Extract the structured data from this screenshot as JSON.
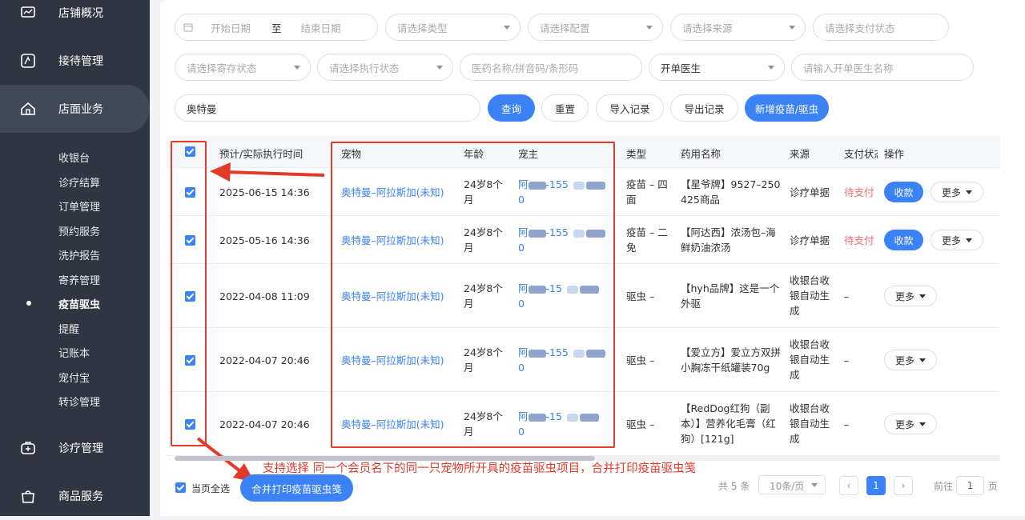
{
  "sidebar": {
    "top_items": [
      {
        "label": "店铺概况",
        "icon": "store-overview-icon"
      },
      {
        "label": "接待管理",
        "icon": "reception-icon"
      },
      {
        "label": "店面业务",
        "icon": "home-icon"
      }
    ],
    "sub_items": [
      "收银台",
      "诊疗结算",
      "订单管理",
      "预约服务",
      "洗护报告",
      "寄养管理",
      "疫苗驱虫",
      "提醒",
      "记账本",
      "宠付宝",
      "转诊管理"
    ],
    "active_sub": "疫苗驱虫",
    "bottom_items": [
      {
        "label": "诊疗管理",
        "icon": "medical-kit-icon"
      },
      {
        "label": "商品服务",
        "icon": "shopping-bag-icon"
      }
    ]
  },
  "filters": {
    "start_date": "开始日期",
    "date_sep": "至",
    "end_date": "结束日期",
    "type": "请选择类型",
    "config": "请选择配置",
    "source": "请选择来源",
    "pay_status": "请选择支付状态",
    "storage_status": "请选择寄存状态",
    "exec_status": "请选择执行状态",
    "drug_search": "医药名称/拼音码/条形码",
    "doctor_select": "开单医生",
    "doctor_name": "请输入开单医生名称",
    "keyword": "奥特曼"
  },
  "actions": {
    "query": "查询",
    "reset": "重置",
    "import": "导入记录",
    "export": "导出记录",
    "add": "新增疫苗/驱虫"
  },
  "table": {
    "headers": {
      "time": "预计/实际执行时间",
      "pet": "宠物",
      "age": "年龄",
      "owner": "宠主",
      "type": "类型",
      "drug": "药用名称",
      "source": "来源",
      "pay": "支付状态",
      "ops": "操作"
    },
    "rows": [
      {
        "time": "2025-06-15 14:36",
        "pet": "奥特曼–阿拉斯加(未知)",
        "age1": "24岁8个",
        "age2": "月",
        "owner1": "阿",
        "owner_mid": "-155",
        "owner2": "0",
        "type1": "疫苗 – 四",
        "type2": "面",
        "drug1": "【星爷牌】9527–250",
        "drug2": "425商品",
        "drug3": "",
        "source1": "诊疗单据",
        "source2": "",
        "source3": "",
        "pay": "待支付",
        "pay_btn": "收款",
        "more": "更多"
      },
      {
        "time": "2025-05-16 14:36",
        "pet": "奥特曼–阿拉斯加(未知)",
        "age1": "24岁8个",
        "age2": "月",
        "owner1": "阿",
        "owner_mid": "-155",
        "owner2": "0",
        "type1": "疫苗 – 二",
        "type2": "免",
        "drug1": "【阿达西】浓汤包–海",
        "drug2": "鲜奶油浓汤",
        "drug3": "",
        "source1": "诊疗单据",
        "source2": "",
        "source3": "",
        "pay": "待支付",
        "pay_btn": "收款",
        "more": "更多"
      },
      {
        "time": "2022-04-08 11:09",
        "pet": "奥特曼–阿拉斯加(未知)",
        "age1": "24岁8个",
        "age2": "月",
        "owner1": "阿",
        "owner_mid": "-15",
        "owner2": "0",
        "type1": "驱虫 –",
        "type2": "",
        "drug1": "【hyh品牌】这是一个",
        "drug2": "外驱",
        "drug3": "",
        "source1": "收银台收",
        "source2": "银自动生",
        "source3": "成",
        "pay": "–",
        "pay_btn": "",
        "more": "更多"
      },
      {
        "time": "2022-04-07 20:46",
        "pet": "奥特曼–阿拉斯加(未知)",
        "age1": "24岁8个",
        "age2": "月",
        "owner1": "阿",
        "owner_mid": "-155",
        "owner2": "0",
        "type1": "驱虫 –",
        "type2": "",
        "drug1": "【爱立方】爱立方双拼",
        "drug2": "小胸冻干纸罐装70g",
        "drug3": "",
        "source1": "收银台收",
        "source2": "银自动生",
        "source3": "成",
        "pay": "–",
        "pay_btn": "",
        "more": "更多"
      },
      {
        "time": "2022-04-07 20:46",
        "pet": "奥特曼–阿拉斯加(未知)",
        "age1": "24岁8个",
        "age2": "月",
        "owner1": "阿",
        "owner_mid": "-15",
        "owner2": "0",
        "type1": "驱虫 –",
        "type2": "",
        "drug1": "【RedDog红狗（副",
        "drug2": "本）】营养化毛膏（红",
        "drug3": "狗）[121g]",
        "source1": "收银台收",
        "source2": "银自动生",
        "source3": "成",
        "pay": "–",
        "pay_btn": "",
        "more": "更多"
      }
    ]
  },
  "footer": {
    "select_all": "当页全选",
    "merge_print": "合并打印疫苗驱虫笺",
    "total": "共 5 条",
    "page_size": "10条/页",
    "prev": "‹",
    "current_page": "1",
    "next": "›",
    "goto": "前往",
    "goto_value": "1",
    "page_unit": "页"
  },
  "annotation": "支持选择 同一个会员名下的同一只宠物所开具的疫苗驱虫项目，合并打印疫苗驱虫笺",
  "colors": {
    "accent": "#3a82f6",
    "sidebar": "#303641",
    "annotation": "#e23b2a",
    "unpaid": "#f56c6c"
  }
}
